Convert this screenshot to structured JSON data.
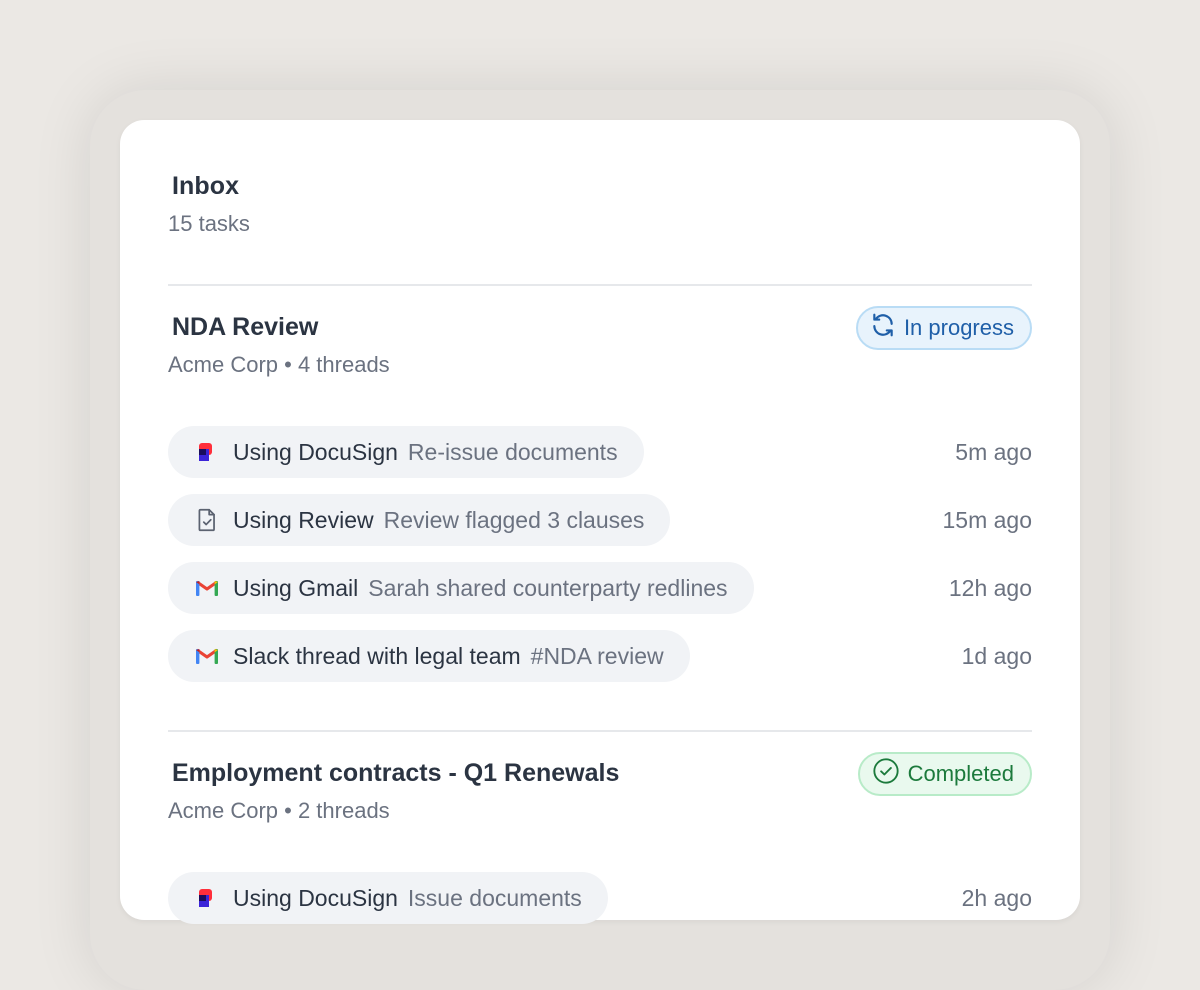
{
  "inbox": {
    "title": "Inbox",
    "count": "15 tasks"
  },
  "groups": [
    {
      "title": "NDA Review",
      "subtitle": "Acme Corp • 4 threads",
      "status": {
        "label": "In progress",
        "icon": "refresh-icon",
        "color": "#1f5fa8"
      },
      "threads": [
        {
          "icon": "docusign-icon",
          "label": "Using DocuSign",
          "detail": "Re-issue documents",
          "time": "5m ago"
        },
        {
          "icon": "document-check-icon",
          "label": "Using Review",
          "detail": "Review flagged 3 clauses",
          "time": "15m ago"
        },
        {
          "icon": "gmail-icon",
          "label": "Using Gmail",
          "detail": "Sarah shared counterparty redlines",
          "time": "12h ago"
        },
        {
          "icon": "gmail-icon",
          "label": "Slack thread with legal team",
          "detail": "#NDA review",
          "time": "1d ago"
        }
      ]
    },
    {
      "title": "Employment contracts - Q1 Renewals",
      "subtitle": "Acme Corp • 2 threads",
      "status": {
        "label": "Completed",
        "icon": "check-circle-icon",
        "color": "#1c7a3c"
      },
      "threads": [
        {
          "icon": "docusign-icon",
          "label": "Using DocuSign",
          "detail": "Issue documents",
          "time": "2h ago"
        }
      ]
    }
  ]
}
